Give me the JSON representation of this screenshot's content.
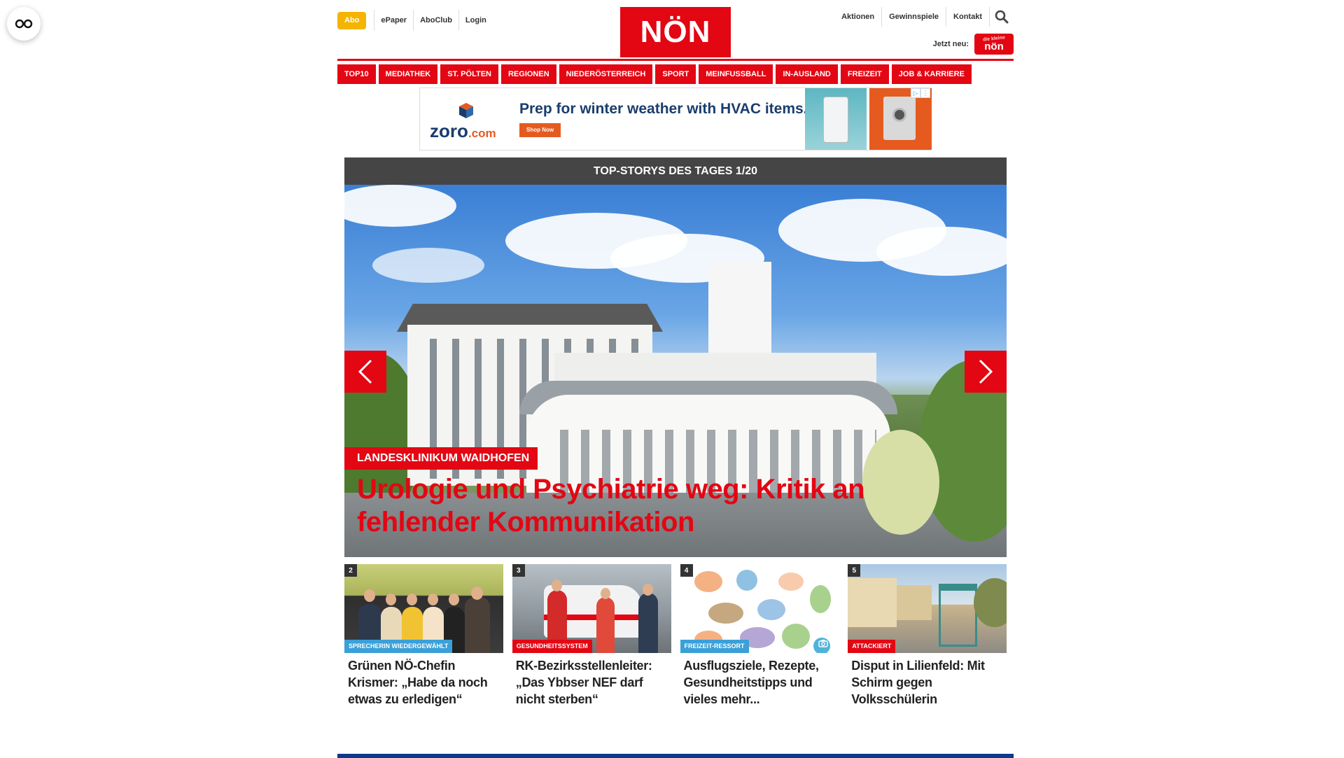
{
  "top_left": {
    "abo": "Abo",
    "links": [
      "ePaper",
      "AboClub",
      "Login"
    ]
  },
  "logo": {
    "text": "NÖN"
  },
  "top_right": {
    "links": [
      "Aktionen",
      "Gewinnspiele",
      "Kontakt"
    ],
    "jetzt_label": "Jetzt neu:",
    "kleine_logo_top": "die kleine",
    "kleine_logo_main": "nön"
  },
  "nav": {
    "items": [
      "TOP10",
      "MEDIATHEK",
      "ST. PÖLTEN",
      "REGIONEN",
      "NIEDERÖSTERREICH",
      "SPORT",
      "MEINFUSSBALL",
      "IN-AUSLAND",
      "FREIZEIT",
      "JOB & KARRIERE"
    ]
  },
  "ad": {
    "brand": "zoro",
    "brand_suffix": ".com",
    "headline": "Prep for winter weather with HVAC items.",
    "cta": "Shop Now"
  },
  "top_stories": {
    "header": "TOP-STORYS DES TAGES 1/20",
    "hero": {
      "kicker": "LANDESKLINIKUM WAIDHOFEN",
      "title": "Urologie und Psychiatrie weg: Kritik an fehlender Kommunikation"
    },
    "cards": [
      {
        "num": "2",
        "tag": "SPRECHERIN WIEDERGEWÄHLT",
        "tag_color": "#3aa0d8",
        "title": "Grünen NÖ-Chefin Krismer: „Habe da noch etwas zu erledigen“"
      },
      {
        "num": "3",
        "tag": "GESUNDHEITSSYSTEM",
        "tag_color": "#e30613",
        "title": "RK-Bezirksstellenleiter: „Das Ybbser NEF darf nicht sterben“"
      },
      {
        "num": "4",
        "tag": "FREIZEIT-RESSORT",
        "tag_color": "#3aa0d8",
        "title": "Ausflugsziele, Rezepte, Gesundheitstipps und vieles mehr..."
      },
      {
        "num": "5",
        "tag": "ATTACKIERT",
        "tag_color": "#e30613",
        "title": "Disput in Lilienfeld: Mit Schirm gegen Volksschülerin"
      }
    ]
  },
  "colors": {
    "brand_red": "#e30613",
    "abo_yellow": "#f5b400",
    "header_gray": "#454545",
    "bottom_blue": "#0b3a8c"
  }
}
